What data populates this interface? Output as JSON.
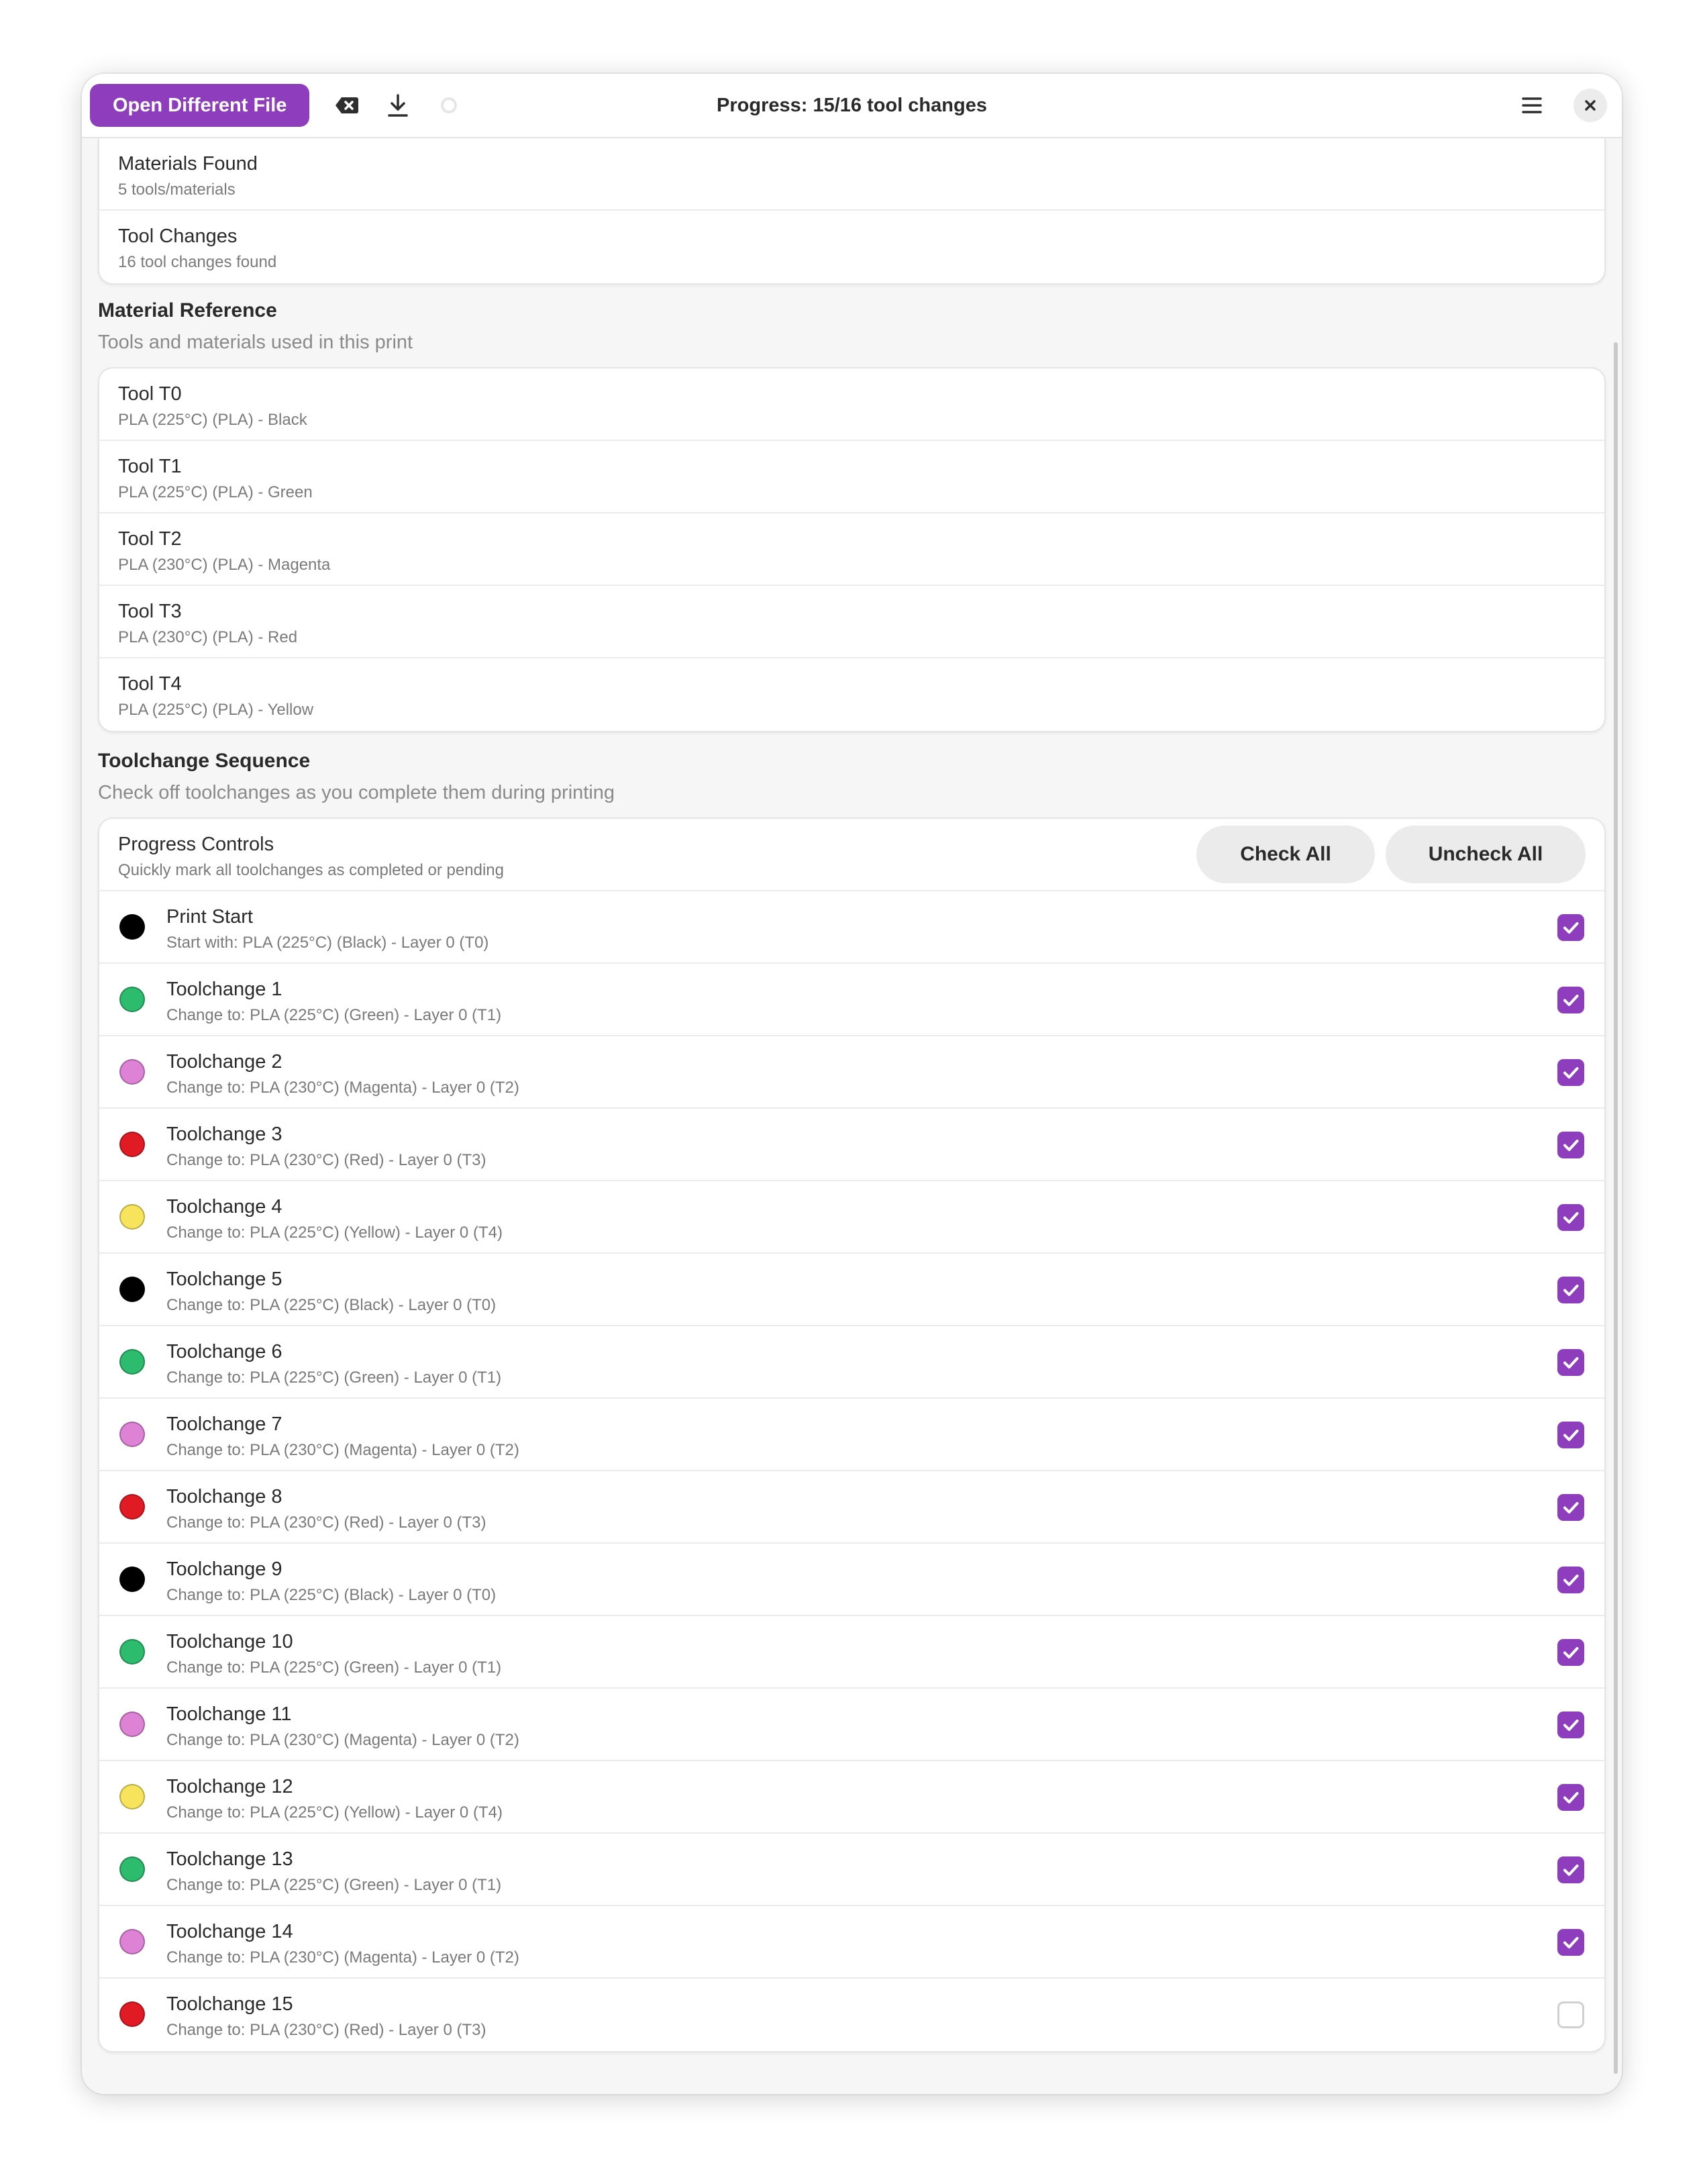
{
  "header": {
    "open_button": "Open Different File",
    "title": "Progress: 15/16 tool changes"
  },
  "summary": [
    {
      "title": "Materials Found",
      "subtitle": "5 tools/materials"
    },
    {
      "title": "Tool Changes",
      "subtitle": "16 tool changes found"
    }
  ],
  "material_reference": {
    "title": "Material Reference",
    "subtitle": "Tools and materials used in this print",
    "tools": [
      {
        "title": "Tool T0",
        "subtitle": "PLA (225°C) (PLA) - Black"
      },
      {
        "title": "Tool T1",
        "subtitle": "PLA (225°C) (PLA) - Green"
      },
      {
        "title": "Tool T2",
        "subtitle": "PLA (230°C) (PLA) - Magenta"
      },
      {
        "title": "Tool T3",
        "subtitle": "PLA (230°C) (PLA) - Red"
      },
      {
        "title": "Tool T4",
        "subtitle": "PLA (225°C) (PLA) - Yellow"
      }
    ]
  },
  "sequence": {
    "title": "Toolchange Sequence",
    "subtitle": "Check off toolchanges as you complete them during printing",
    "controls": {
      "title": "Progress Controls",
      "subtitle": "Quickly mark all toolchanges as completed or pending",
      "check_all": "Check All",
      "uncheck_all": "Uncheck All"
    },
    "colors": {
      "black": "#000000",
      "green": "#2dbb6e",
      "magenta": "#de82d6",
      "red": "#e01b24",
      "yellow": "#f8e45c"
    },
    "items": [
      {
        "title": "Print Start",
        "subtitle": "Start with: PLA (225°C) (Black) - Layer 0 (T0)",
        "color": "#000000",
        "checked": true
      },
      {
        "title": "Toolchange 1",
        "subtitle": "Change to: PLA (225°C) (Green) - Layer 0 (T1)",
        "color": "#2dbb6e",
        "checked": true
      },
      {
        "title": "Toolchange 2",
        "subtitle": "Change to: PLA (230°C) (Magenta) - Layer 0 (T2)",
        "color": "#de82d6",
        "checked": true
      },
      {
        "title": "Toolchange 3",
        "subtitle": "Change to: PLA (230°C) (Red) - Layer 0 (T3)",
        "color": "#e01b24",
        "checked": true
      },
      {
        "title": "Toolchange 4",
        "subtitle": "Change to: PLA (225°C) (Yellow) - Layer 0 (T4)",
        "color": "#f8e45c",
        "checked": true
      },
      {
        "title": "Toolchange 5",
        "subtitle": "Change to: PLA (225°C) (Black) - Layer 0 (T0)",
        "color": "#000000",
        "checked": true
      },
      {
        "title": "Toolchange 6",
        "subtitle": "Change to: PLA (225°C) (Green) - Layer 0 (T1)",
        "color": "#2dbb6e",
        "checked": true
      },
      {
        "title": "Toolchange 7",
        "subtitle": "Change to: PLA (230°C) (Magenta) - Layer 0 (T2)",
        "color": "#de82d6",
        "checked": true
      },
      {
        "title": "Toolchange 8",
        "subtitle": "Change to: PLA (230°C) (Red) - Layer 0 (T3)",
        "color": "#e01b24",
        "checked": true
      },
      {
        "title": "Toolchange 9",
        "subtitle": "Change to: PLA (225°C) (Black) - Layer 0 (T0)",
        "color": "#000000",
        "checked": true
      },
      {
        "title": "Toolchange 10",
        "subtitle": "Change to: PLA (225°C) (Green) - Layer 0 (T1)",
        "color": "#2dbb6e",
        "checked": true
      },
      {
        "title": "Toolchange 11",
        "subtitle": "Change to: PLA (230°C) (Magenta) - Layer 0 (T2)",
        "color": "#de82d6",
        "checked": true
      },
      {
        "title": "Toolchange 12",
        "subtitle": "Change to: PLA (225°C) (Yellow) - Layer 0 (T4)",
        "color": "#f8e45c",
        "checked": true
      },
      {
        "title": "Toolchange 13",
        "subtitle": "Change to: PLA (225°C) (Green) - Layer 0 (T1)",
        "color": "#2dbb6e",
        "checked": true
      },
      {
        "title": "Toolchange 14",
        "subtitle": "Change to: PLA (230°C) (Magenta) - Layer 0 (T2)",
        "color": "#de82d6",
        "checked": true
      },
      {
        "title": "Toolchange 15",
        "subtitle": "Change to: PLA (230°C) (Red) - Layer 0 (T3)",
        "color": "#e01b24",
        "checked": false
      }
    ]
  },
  "accent_color": "#8e3dbd",
  "icons": [
    "clear-icon",
    "download-icon",
    "spinner-icon",
    "menu-icon",
    "close-icon",
    "checkmark-icon"
  ]
}
